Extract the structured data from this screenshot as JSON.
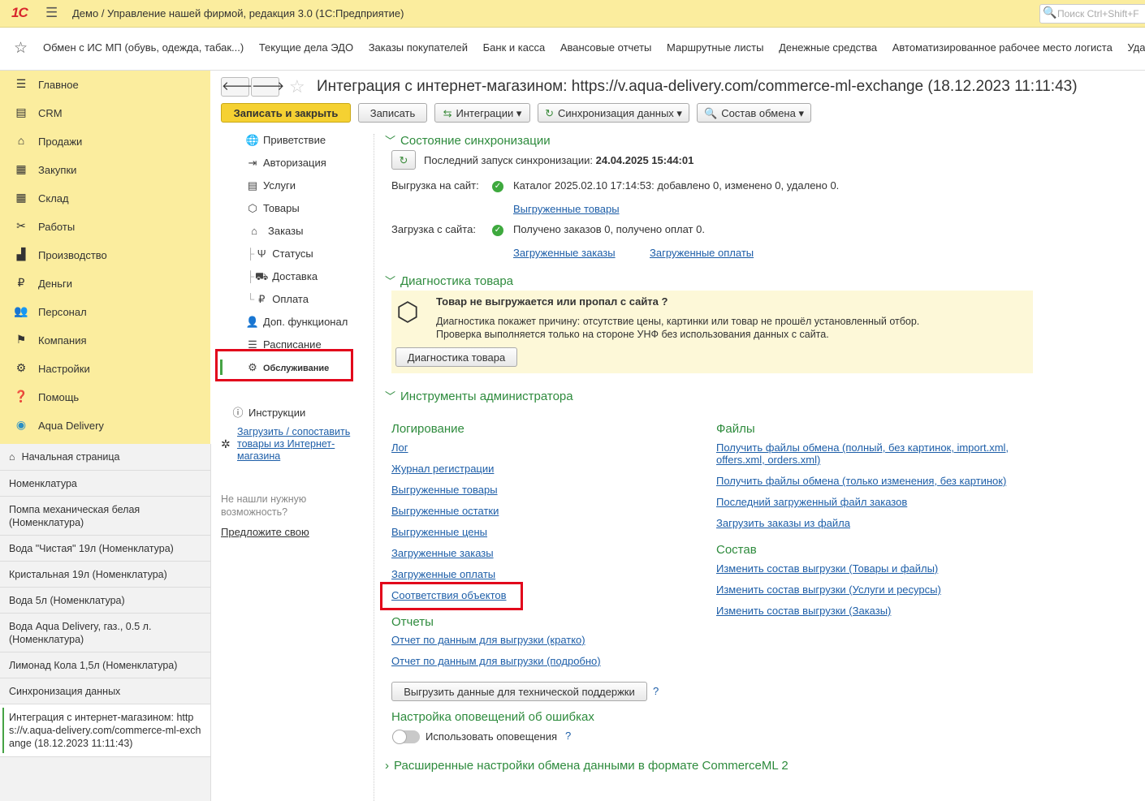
{
  "topbar": {
    "logo": "1С",
    "app_title": "Демо / Управление нашей фирмой, редакция 3.0  (1С:Предприятие)",
    "search_placeholder": "Поиск Ctrl+Shift+F"
  },
  "favorites": [
    "Обмен с ИС МП (обувь, одежда, табак...)",
    "Текущие дела ЭДО",
    "Заказы покупателей",
    "Банк и касса",
    "Авансовые отчеты",
    "Маршрутные листы",
    "Денежные средства",
    "Автоматизированное рабочее место логиста",
    "Удал"
  ],
  "sidebar": {
    "items": [
      {
        "label": "Главное",
        "icon": "menu-icon"
      },
      {
        "label": "CRM",
        "icon": "crm-icon"
      },
      {
        "label": "Продажи",
        "icon": "basket-icon"
      },
      {
        "label": "Закупки",
        "icon": "cart-icon"
      },
      {
        "label": "Склад",
        "icon": "warehouse-icon"
      },
      {
        "label": "Работы",
        "icon": "tools-icon"
      },
      {
        "label": "Производство",
        "icon": "factory-icon"
      },
      {
        "label": "Деньги",
        "icon": "ruble-icon"
      },
      {
        "label": "Персонал",
        "icon": "people-icon"
      },
      {
        "label": "Компания",
        "icon": "flag-icon"
      },
      {
        "label": "Настройки",
        "icon": "gear-icon"
      },
      {
        "label": "Помощь",
        "icon": "help-icon"
      },
      {
        "label": "Aqua Delivery",
        "icon": "location-icon"
      }
    ]
  },
  "open_windows": [
    "Начальная страница",
    "Номенклатура",
    "Помпа механическая белая (Номенклатура)",
    "Вода \"Чистая\" 19л (Номенклатура)",
    "Кристальная 19л (Номенклатура)",
    "Вода 5л (Номенклатура)",
    "Вода Aqua Delivery, газ., 0.5 л. (Номенклатура)",
    "Лимонад Кола 1,5л (Номенклатура)",
    "Синхронизация данных",
    "Интеграция с интернет-магазином: https://v.aqua-delivery.com/commerce-ml-exchange (18.12.2023 11:11:43)"
  ],
  "form": {
    "title": "Интеграция с интернет-магазином: https://v.aqua-delivery.com/commerce-ml-exchange (18.12.2023 11:11:43)",
    "btn_save_close": "Записать и закрыть",
    "btn_save": "Записать",
    "btn_integrations": "Интеграции",
    "btn_sync": "Синхронизация данных",
    "btn_exchange": "Состав обмена"
  },
  "sections": [
    {
      "label": "Приветствие",
      "icon": "globe-icon"
    },
    {
      "label": "Авторизация",
      "icon": "login-icon"
    },
    {
      "label": "Услуги",
      "icon": "document-icon"
    },
    {
      "label": "Товары",
      "icon": "box-icon"
    },
    {
      "label": "Заказы",
      "icon": "basket-icon"
    },
    {
      "label": "Статусы",
      "icon": "status-icon"
    },
    {
      "label": "Доставка",
      "icon": "truck-icon"
    },
    {
      "label": "Оплата",
      "icon": "ruble-icon"
    },
    {
      "label": "Доп. функционал",
      "icon": "user-icon"
    },
    {
      "label": "Расписание",
      "icon": "schedule-icon"
    },
    {
      "label": "Обслуживание",
      "icon": "gear-icon"
    }
  ],
  "side_extra": {
    "instructions": "Инструкции",
    "load_link": "Загрузить / сопоставить товары из Интернет-магазина",
    "not_found": "Не нашли нужную возможность?",
    "suggest": "Предложите свою"
  },
  "sync_state": {
    "heading": "Состояние синхронизации",
    "last_run_label": "Последний запуск синхронизации:",
    "last_run_value": "24.04.2025 15:44:01",
    "upload_label": "Выгрузка на сайт:",
    "upload_status": "Каталог 2025.02.10 17:14:53: добавлено 0, изменено 0, удалено 0.",
    "upload_link": "Выгруженные товары",
    "download_label": "Загрузка с сайта:",
    "download_status": "Получено заказов 0, получено оплат 0.",
    "download_link1": "Загруженные заказы",
    "download_link2": "Загруженные оплаты"
  },
  "diagnostics": {
    "heading": "Диагностика товара",
    "question": "Товар не выгружается или пропал с сайта ?",
    "line1": "Диагностика покажет причину: отсутствие цены, картинки или товар не прошёл установленный отбор.",
    "line2": "Проверка выполняется только на стороне УНФ без использования данных с сайта.",
    "button": "Диагностика товара"
  },
  "admin": {
    "heading": "Инструменты администратора",
    "logging_title": "Логирование",
    "logging_links": [
      "Лог",
      "Журнал регистрации",
      "Выгруженные товары",
      "Выгруженные остатки",
      "Выгруженные цены",
      "Загруженные заказы",
      "Загруженные оплаты",
      "Соответствия объектов"
    ],
    "files_title": "Файлы",
    "files_link1a": "Получить файлы обмена (полный, без картинок, import.xml,",
    "files_link1b": "offers.xml, orders.xml)",
    "files_link2": "Получить файлы обмена (только изменения, без картинок)",
    "files_link3": "Последний загруженный файл заказов",
    "files_link4": "Загрузить заказы из файла",
    "composition_title": "Состав",
    "composition_links": [
      "Изменить состав выгрузки (Товары и файлы)",
      "Изменить состав выгрузки (Услуги и ресурсы)",
      "Изменить состав выгрузки (Заказы)"
    ],
    "reports_title": "Отчеты",
    "reports_links": [
      "Отчет по данным для выгрузки (кратко)",
      "Отчет по данным для выгрузки (подробно)"
    ],
    "support_button": "Выгрузить данные для технической поддержки",
    "question_mark": "?",
    "notify_title": "Настройка оповещений об ошибках",
    "notify_toggle_label": "Использовать оповещения",
    "notify_toggle_on": false,
    "extended": "Расширенные настройки обмена данными в формате CommerceML 2"
  },
  "colors": {
    "accent_yellow": "#fbed9e",
    "primary_button": "#f5d132",
    "green": "#2e8b3d",
    "link": "#1d5ea8",
    "highlight": "#e2051b"
  }
}
